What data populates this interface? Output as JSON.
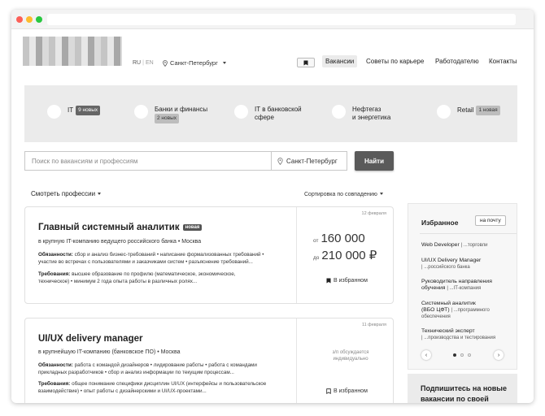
{
  "header": {
    "lang_ru": "RU",
    "lang_en": "EN",
    "city": "Санкт-Петербург",
    "nav": [
      "Вакансии",
      "Советы по карьере",
      "Работодателю",
      "Контакты"
    ]
  },
  "categories": [
    {
      "name_1": "IT",
      "name_2": "",
      "badge": "9 новых"
    },
    {
      "name_1": "Банки и финансы",
      "name_2": "",
      "badge": "2 новых"
    },
    {
      "name_1": "IT в банковской",
      "name_2": "сфере",
      "badge": ""
    },
    {
      "name_1": "Нефтегаз",
      "name_2": "и энергетика",
      "badge": ""
    },
    {
      "name_1": "Retail",
      "name_2": "",
      "badge": "1 новая"
    }
  ],
  "search": {
    "placeholder": "Поиск по вакансиям и профессиям",
    "city": "Санкт-Петербург",
    "button": "Найти"
  },
  "filters": {
    "professions": "Смотреть профессии",
    "sort": "Сортировка по совпадению"
  },
  "jobs": [
    {
      "title": "Главный системный аналитик",
      "badge": "новая",
      "company": "в крупную IT-компанию ведущего российского банка • Москва",
      "duties_label": "Обязанности:",
      "duties_1": "сбор и анализ бизнес-требований • написание формализованных требований •",
      "duties_2": "участие во встречах с пользователями и заказчиками систем • разъяснение требований...",
      "req_label": "Требования:",
      "req_1": "высшее образование по профилю (математическое, экономическое,",
      "req_2": "техническое) • минимум 2 года опыта работы в различных ролях...",
      "date": "12 февраля",
      "salary_from_label": "от",
      "salary_from": "160 000",
      "salary_to_label": "до",
      "salary_to": "210 000 ₽",
      "favorite": "В избранном"
    },
    {
      "title": "UI/UX delivery manager",
      "company": "в крупнейшую IT-компанию (банковское ПО) • Москва",
      "duties_label": "Обязанности:",
      "duties_1": "работа с командой дизайнеров • лидирование работы • работа с командами",
      "duties_2": "прикладных разработчиков • сбор и анализ информации по текущим процессам...",
      "req_label": "Требования:",
      "req_1": "общее понимание специфики дисциплин UI/UX (интерфейсы и пользовательское",
      "req_2": "взаимодействие) • опыт работы с дизайнерскими и UI/UX-проектами...",
      "date": "11 февраля",
      "salary_note_1": "з/п обсуждается",
      "salary_note_2": "индивидуально",
      "favorite": "В избранном"
    }
  ],
  "sidebar": {
    "title": "Избранное",
    "mail_button": "на почту",
    "items": [
      {
        "title": "Web Developer",
        "sub": "| ...торговли",
        "title2": ""
      },
      {
        "title": "UI/UX Delivery Manager",
        "sub": "| ...российского банка",
        "title2": ""
      },
      {
        "title": "Руководитель направления",
        "title2": "обучения",
        "sub": "| ...IT-компания"
      },
      {
        "title": "Системный аналитик",
        "title2": "(ВБО ЦФТ)",
        "sub": "| ...программного обеспечения"
      },
      {
        "title": "Технический эксперт",
        "title2": "",
        "sub": "| ...производства и тестирования"
      }
    ],
    "prev": "‹",
    "next": "›"
  },
  "subscribe": {
    "text": "Подпишитесь на новые вакансии по своей профессии"
  },
  "colors": {
    "accent": "#5a5a5a",
    "panel": "#ebebeb"
  }
}
